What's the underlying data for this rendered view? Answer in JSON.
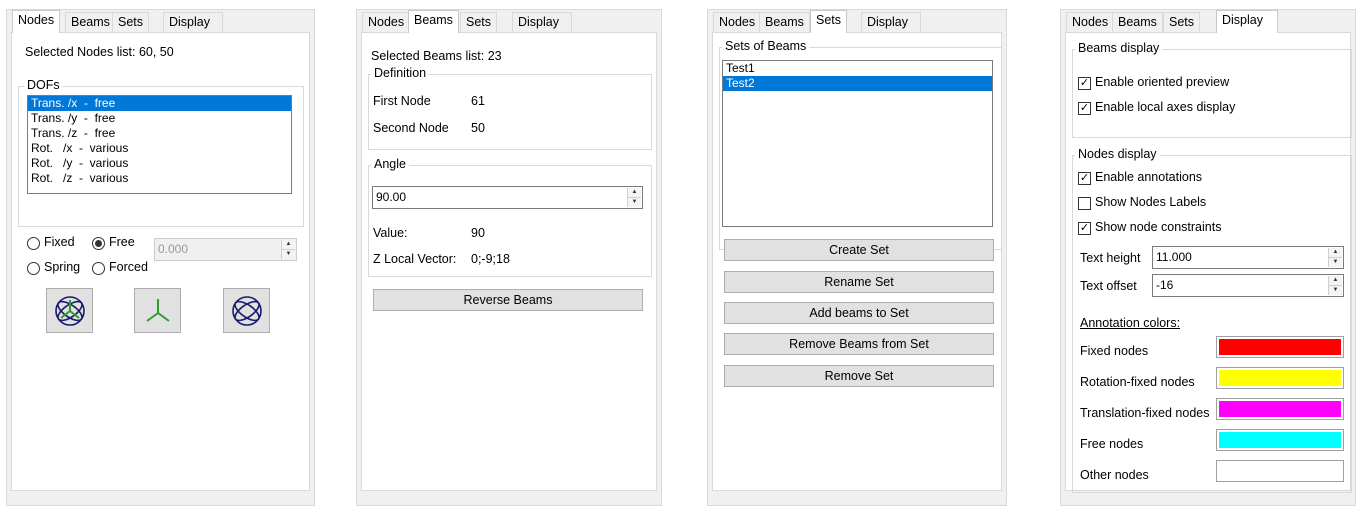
{
  "tabs": [
    "Nodes",
    "Beams",
    "Sets",
    "Display"
  ],
  "nodes_panel": {
    "selected_label": "Selected Nodes list: 60, 50",
    "dofs_title": "DOFs",
    "dofs": [
      "Trans. /x  -  free",
      "Trans. /y  -  free",
      "Trans. /z  -  free",
      "Rot.   /x  -  various",
      "Rot.   /y  -  various",
      "Rot.   /z  -  various"
    ],
    "radio_fixed": "Fixed",
    "radio_free": "Free",
    "radio_spring": "Spring",
    "radio_forced": "Forced",
    "value": "0.000",
    "icons": [
      "rotation-gizmo-icon",
      "axes-triad-icon",
      "rotation-orbit-icon"
    ]
  },
  "beams_panel": {
    "selected_label": "Selected Beams list: 23",
    "definition_title": "Definition",
    "first_node_label": "First Node",
    "first_node_value": "61",
    "second_node_label": "Second Node",
    "second_node_value": "50",
    "angle_title": "Angle",
    "angle_value": "90.00",
    "value_label": "Value:",
    "value_value": "90",
    "zvec_label": "Z Local Vector:",
    "zvec_value": "0;-9;18",
    "reverse_button": "Reverse Beams"
  },
  "sets_panel": {
    "group_title": "Sets of Beams",
    "sets": [
      "Test1",
      "Test2"
    ],
    "buttons": [
      "Create Set",
      "Rename Set",
      "Add beams to Set",
      "Remove Beams from Set",
      "Remove Set"
    ]
  },
  "display_panel": {
    "beams_display_title": "Beams display",
    "enable_oriented_preview": "Enable oriented preview",
    "enable_local_axes": "Enable local axes display",
    "nodes_display_title": "Nodes display",
    "enable_annotations": "Enable annotations",
    "show_nodes_labels": "Show Nodes Labels",
    "show_node_constraints": "Show node constraints",
    "text_height_label": "Text height",
    "text_height_value": "11.000",
    "text_offset_label": "Text offset",
    "text_offset_value": "-16",
    "annotation_colors_label": "Annotation colors:",
    "color_rows": [
      {
        "label": "Fixed nodes",
        "color": "#ff0000"
      },
      {
        "label": "Rotation-fixed nodes",
        "color": "#ffff00"
      },
      {
        "label": "Translation-fixed nodes",
        "color": "#ff00ff"
      },
      {
        "label": "Free nodes",
        "color": "#00ffff"
      },
      {
        "label": "Other nodes",
        "color": "#ffffff"
      }
    ]
  }
}
